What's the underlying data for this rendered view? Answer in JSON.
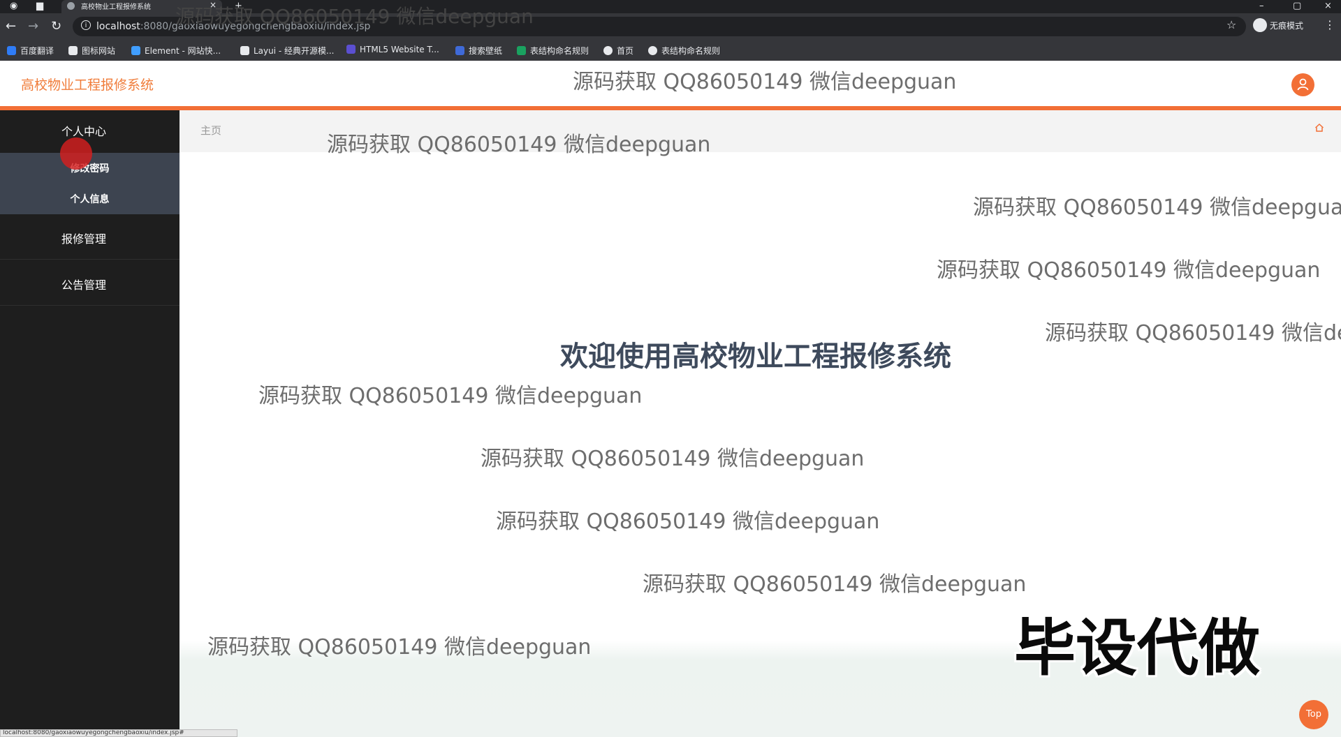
{
  "browser": {
    "tab_title": "高校物业工程报修系统",
    "tab_close": "×",
    "new_tab": "+",
    "url_host": "localhost",
    "url_rest": ":8080/gaoxiaowuyegongchengbaoxiu/index.jsp",
    "incognito_label": "无痕模式",
    "bookmarks": [
      {
        "label": "百度翻译",
        "color": "#2f7cf6"
      },
      {
        "label": "图标网站",
        "color": "#e8eaed"
      },
      {
        "label": "Element - 网站快...",
        "color": "#409eff"
      },
      {
        "label": "Layui - 经典开源模...",
        "color": "#e8eaed"
      },
      {
        "label": "HTML5 Website T...",
        "color": "#5b4fd1"
      },
      {
        "label": "搜索壁纸",
        "color": "#3f6ad8"
      },
      {
        "label": "表结构命名规则",
        "color": "#1aa260"
      },
      {
        "label": "首页",
        "color": "#e8eaed"
      },
      {
        "label": "表结构命名规则",
        "color": "#e8eaed"
      }
    ]
  },
  "header": {
    "app_title": "高校物业工程报修系统"
  },
  "sidebar": {
    "groups": [
      {
        "label": "个人中心",
        "items": [
          "修改密码",
          "个人信息"
        ]
      },
      {
        "label": "报修管理",
        "items": []
      },
      {
        "label": "公告管理",
        "items": []
      }
    ]
  },
  "breadcrumb": {
    "home": "主页"
  },
  "main": {
    "welcome": "欢迎使用高校物业工程报修系统",
    "top_button": "Top"
  },
  "overlay": {
    "watermark": "源码获取 QQ86050149 微信deepguan",
    "promo": "毕设代做"
  },
  "statusbar": {
    "url": "localhost:8080/gaoxiaowuyegongchengbaoxiu/index.jsp#"
  },
  "colors": {
    "accent": "#f26f36",
    "sidebar_bg": "#1e1e1e",
    "submenu_bg": "#3d4450"
  }
}
